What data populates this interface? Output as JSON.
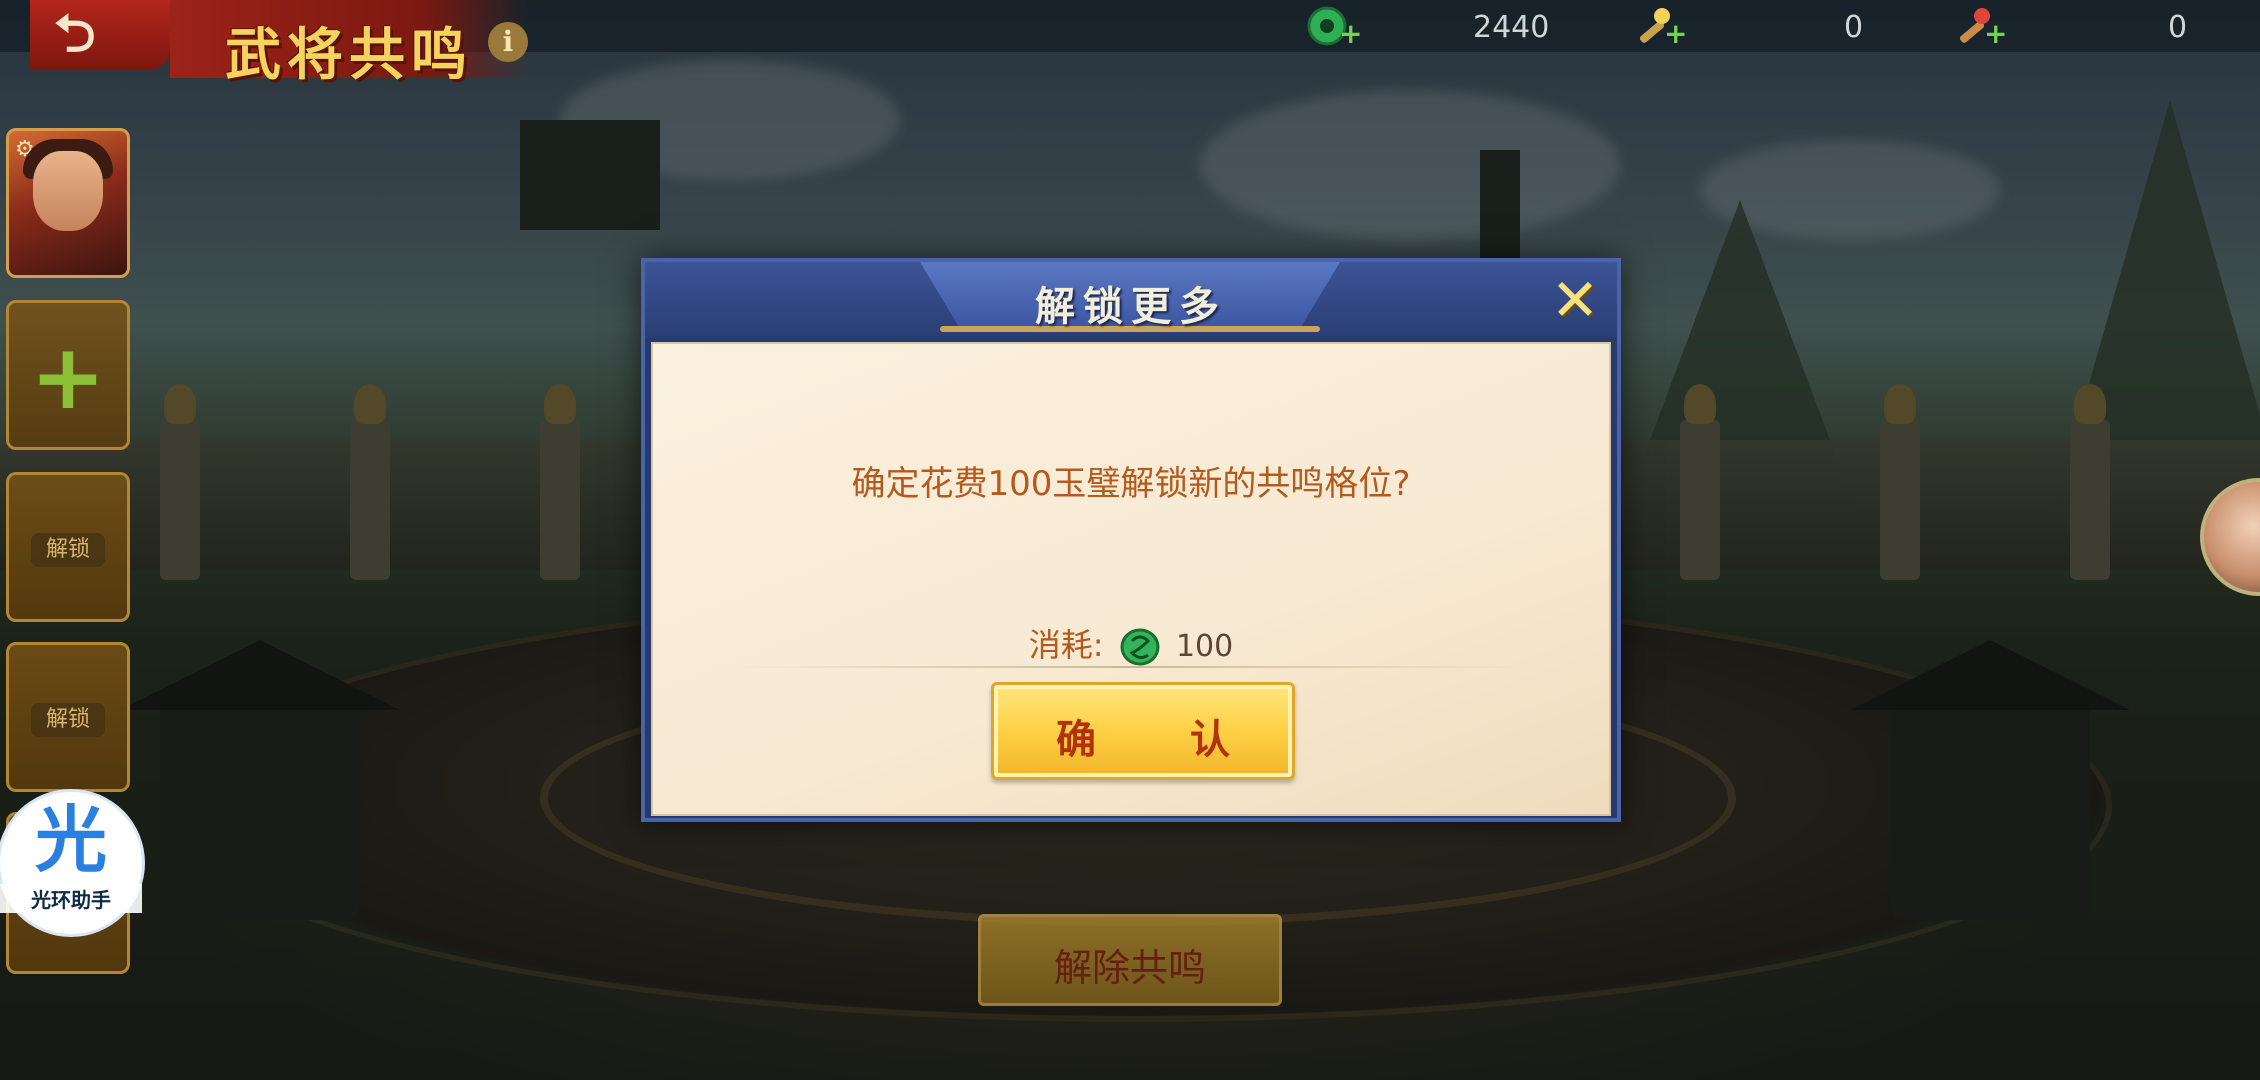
{
  "header": {
    "title": "武将共鸣",
    "info_label": "i",
    "back_icon": "back-arrow-icon"
  },
  "resources": [
    {
      "icon": "jade-coin-icon",
      "value": "2440"
    },
    {
      "icon": "torch-item-icon",
      "value": "0"
    },
    {
      "icon": "red-torch-item-icon",
      "value": "0"
    }
  ],
  "left_slots": [
    {
      "type": "portrait"
    },
    {
      "type": "add",
      "label": "+"
    },
    {
      "type": "locked",
      "label": "解锁"
    },
    {
      "type": "locked",
      "label": "解锁"
    }
  ],
  "assistant": {
    "char": "光",
    "label": "光环助手"
  },
  "release_button": "解除共鸣",
  "dialog": {
    "title": "解锁更多",
    "question": "确定花费100玉璧解锁新的共鸣格位?",
    "cost_label": "消耗:",
    "cost_value": "100",
    "confirm": "确 认",
    "close_icon": "close-icon"
  },
  "colors": {
    "dialog_frame": "#27396e",
    "dialog_text": "#b35a1c",
    "confirm_fill": "#ffd34a",
    "title_gold": "#f4d35e"
  }
}
